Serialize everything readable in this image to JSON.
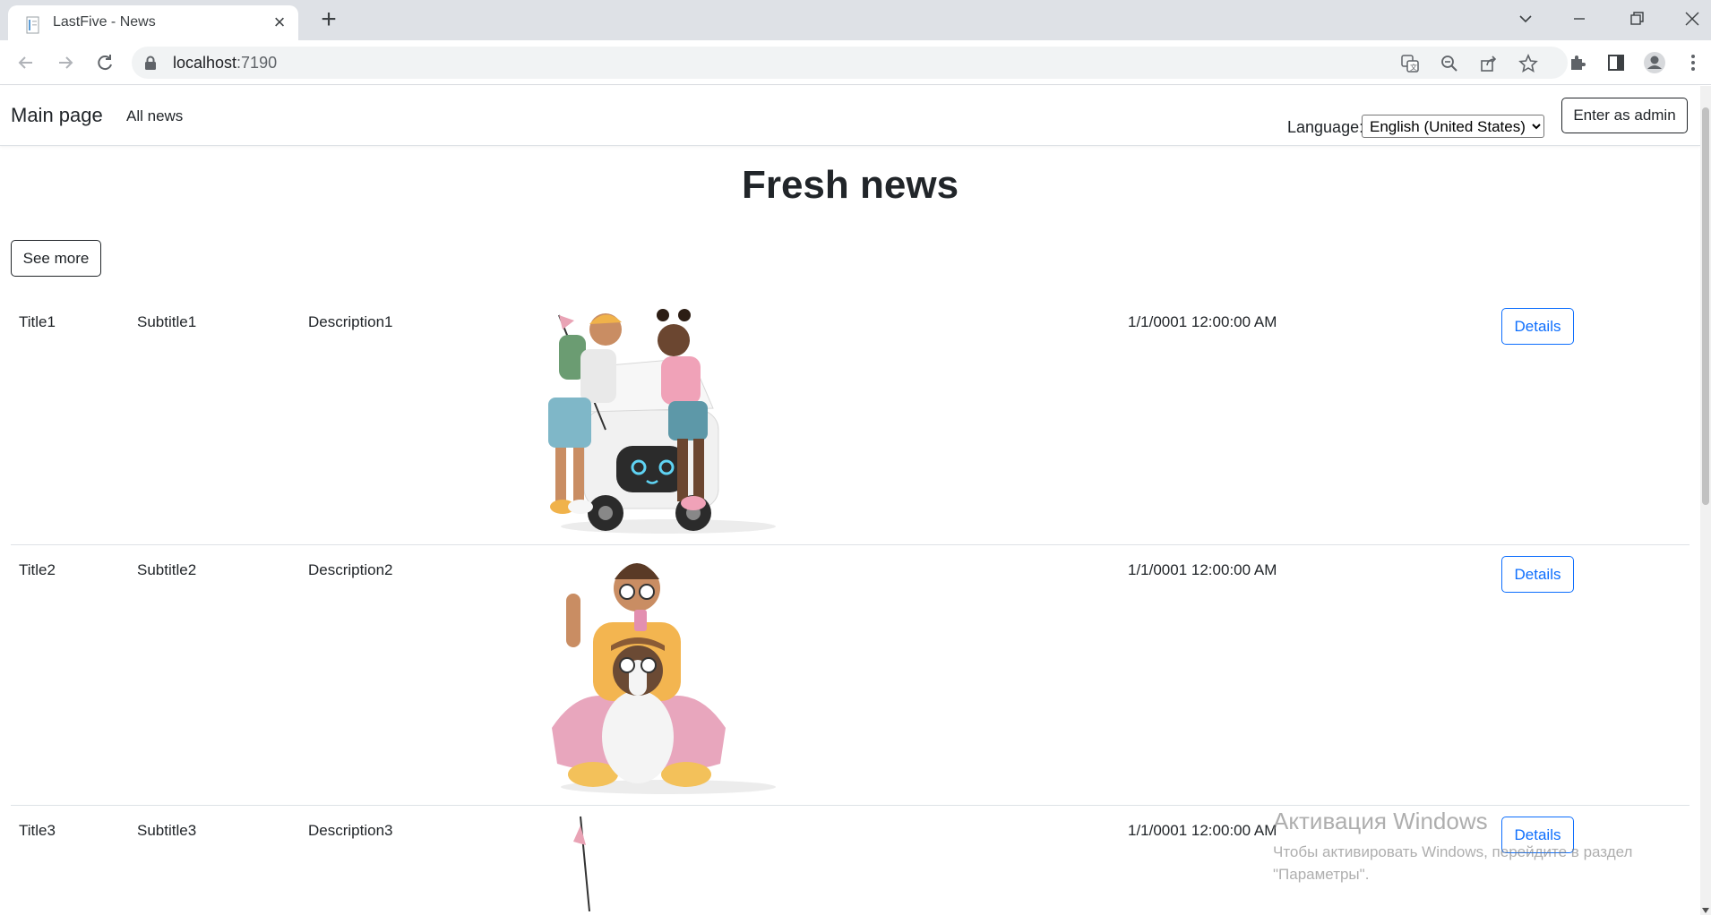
{
  "browser": {
    "tab_title": "LastFive - News",
    "url_host": "localhost",
    "url_port": ":7190"
  },
  "site": {
    "brand": "Main page",
    "nav_all_news": "All news",
    "language_label": "Language:",
    "language_selected": "English (United States)",
    "admin_button": "Enter as admin"
  },
  "main": {
    "heading": "Fresh news",
    "see_more": "See more",
    "rows": [
      {
        "title": "Title1",
        "subtitle": "Subtitle1",
        "description": "Description1",
        "date": "1/1/0001 12:00:00 AM",
        "details": "Details"
      },
      {
        "title": "Title2",
        "subtitle": "Subtitle2",
        "description": "Description2",
        "date": "1/1/0001 12:00:00 AM",
        "details": "Details"
      },
      {
        "title": "Title3",
        "subtitle": "Subtitle3",
        "description": "Description3",
        "date": "1/1/0001 12:00:00 AM",
        "details": "Details"
      }
    ]
  },
  "watermark": {
    "title": "Активация Windows",
    "text": "Чтобы активировать Windows, перейдите в раздел \"Параметры\"."
  },
  "colors": {
    "primary": "#0d6efd",
    "text": "#212529",
    "chrome_bg": "#dee1e6",
    "omnibox_bg": "#f1f3f4"
  }
}
